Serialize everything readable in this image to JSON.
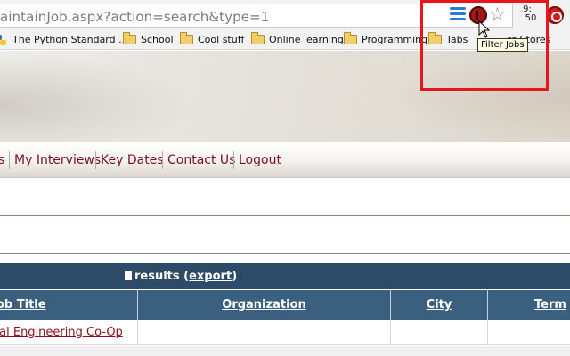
{
  "browser": {
    "url": "aintainJob.aspx?action=search&type=1",
    "clock": {
      "hours": "9:",
      "minutes": "50"
    },
    "tooltip": "Filter Jobs",
    "extensions": [
      "waves-icon",
      "filter-jobs-icon",
      "star-icon",
      "clock-badge",
      "stop-icon"
    ]
  },
  "bookmarks": [
    {
      "label": "The Python Standard ...",
      "icon": "python-icon"
    },
    {
      "label": "School",
      "icon": "folder-icon"
    },
    {
      "label": "Cool stuff",
      "icon": "folder-icon"
    },
    {
      "label": "Online learning",
      "icon": "folder-icon"
    },
    {
      "label": "Programming",
      "icon": "folder-icon"
    },
    {
      "label": "Tabs",
      "icon": "folder-icon"
    },
    {
      "label": "ts Stores",
      "icon": ""
    }
  ],
  "nav": {
    "items": [
      "s",
      "My Interviews",
      "Key Dates",
      "Contact Us",
      "Logout"
    ]
  },
  "results": {
    "label": "results (",
    "export": "export",
    "close": ")"
  },
  "table": {
    "headers": [
      "ob Title",
      "Organization",
      "City",
      "Term"
    ],
    "rows": [
      {
        "job_title": "cal Engineering Co-Op",
        "organization": "",
        "city": "",
        "term": ""
      }
    ]
  },
  "colors": {
    "nav_text": "#7a1020",
    "table_header": "#3b607f",
    "results_bar": "#2c4b68",
    "highlight": "#e5161d"
  }
}
